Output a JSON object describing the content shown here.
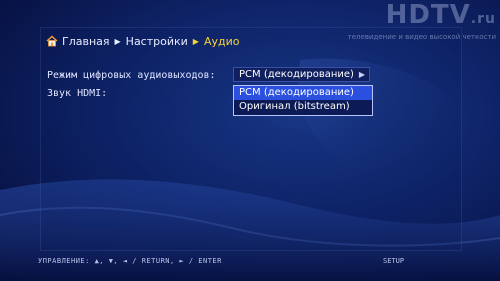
{
  "breadcrumb": {
    "home": "Главная",
    "settings": "Настройки",
    "audio": "Аудио"
  },
  "watermark": {
    "logo": "HDTV",
    "domain": ".ru",
    "tagline": "телевидение и видео высокой четкости"
  },
  "settings": {
    "digital_output_label": "Режим цифровых аудиовыходов:",
    "digital_output_value": "PCM (декодирование)",
    "hdmi_label": "Звук HDMI:",
    "options": [
      "PCM (декодирование)",
      "Оригинал (bitstream)"
    ],
    "selected_option_index": 0
  },
  "footer": {
    "controls": "УПРАВЛЕНИЕ: ▲, ▼, ◄ / RETURN, ► / ENTER",
    "setup": "SETUP"
  },
  "colors": {
    "accent": "#f5d23a",
    "highlight": "#2b50e0"
  }
}
